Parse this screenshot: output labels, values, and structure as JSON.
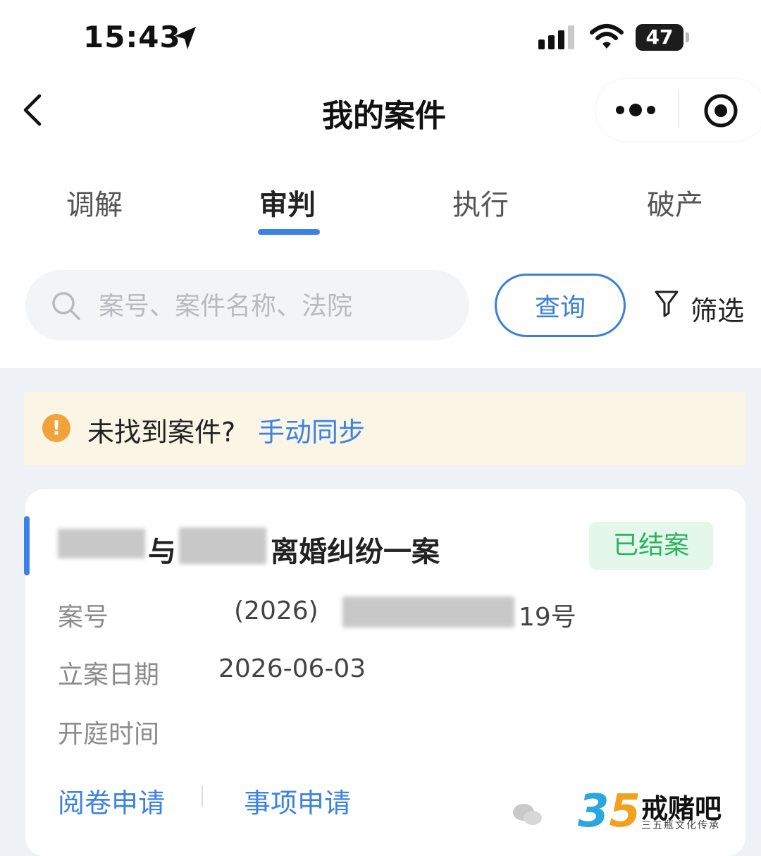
{
  "status_bar": {
    "time": "15:43",
    "battery": "47"
  },
  "nav": {
    "title": "我的案件"
  },
  "tabs": [
    {
      "label": "调解"
    },
    {
      "label": "审判"
    },
    {
      "label": "执行"
    },
    {
      "label": "破产"
    }
  ],
  "active_tab": "审判",
  "search": {
    "placeholder": "案号、案件名称、法院",
    "value": "",
    "button_label": "查询",
    "filter_label": "筛选"
  },
  "notice": {
    "text": "未找到案件?",
    "link": "手动同步"
  },
  "case": {
    "title_joiner": "与",
    "title_suffix": "离婚纠纷一案",
    "status": "已结案",
    "fields": {
      "case_no_label": "案号",
      "case_no_prefix": "(2026)",
      "case_no_suffix": "19号",
      "filing_date_label": "立案日期",
      "filing_date": "2026-06-03",
      "hearing_time_label": "开庭时间",
      "hearing_time": ""
    },
    "actions": {
      "read_files": "阅卷申请",
      "matter_apply": "事项申请"
    }
  },
  "watermark": {
    "digit_3": "3",
    "digit_5": "5",
    "name": "戒赌吧",
    "sub": "三五瓶文化传承"
  },
  "colors": {
    "accent": "#3b82e6",
    "warning": "#f0a33a",
    "success": "#2cb160",
    "notice_bg": "#fbf5e6"
  }
}
